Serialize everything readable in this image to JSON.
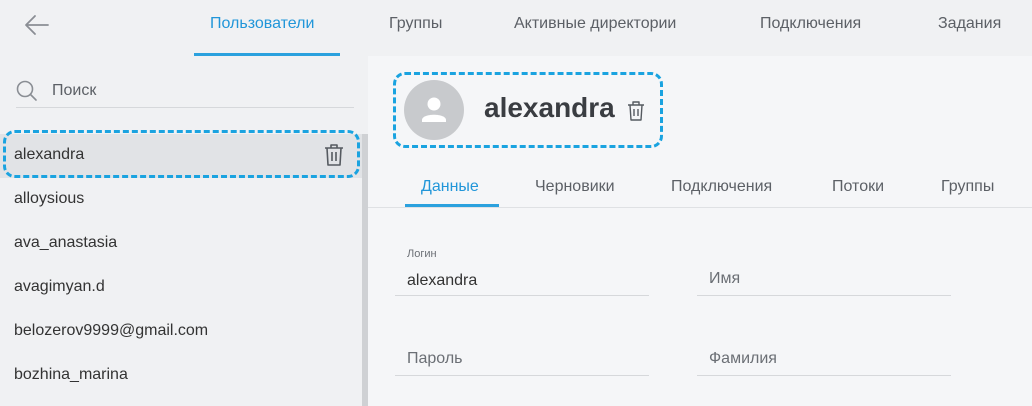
{
  "colors": {
    "accent": "#2196d9",
    "highlight_dash": "#1aa3e0"
  },
  "topbar": {
    "back_icon": "arrow-left-icon",
    "tabs": [
      {
        "label": "Пользователи",
        "active": true
      },
      {
        "label": "Группы"
      },
      {
        "label": "Активные директории"
      },
      {
        "label": "Подключения"
      },
      {
        "label": "Задания"
      }
    ]
  },
  "sidebar": {
    "search": {
      "placeholder": "Поиск",
      "icon": "search-icon"
    },
    "items": [
      {
        "label": "alexandra",
        "selected": true
      },
      {
        "label": "alloysious"
      },
      {
        "label": "ava_anastasia"
      },
      {
        "label": "avagimyan.d"
      },
      {
        "label": "belozerov9999@gmail.com"
      },
      {
        "label": "bozhina_marina"
      }
    ]
  },
  "profile": {
    "username": "alexandra",
    "tabs": [
      {
        "label": "Данные",
        "active": true
      },
      {
        "label": "Черновики"
      },
      {
        "label": "Подключения"
      },
      {
        "label": "Потоки"
      },
      {
        "label": "Группы"
      }
    ],
    "fields": {
      "login": {
        "label": "Логин",
        "value": "alexandra"
      },
      "name": {
        "placeholder": "Имя"
      },
      "password": {
        "placeholder": "Пароль"
      },
      "surname": {
        "placeholder": "Фамилия"
      }
    }
  }
}
